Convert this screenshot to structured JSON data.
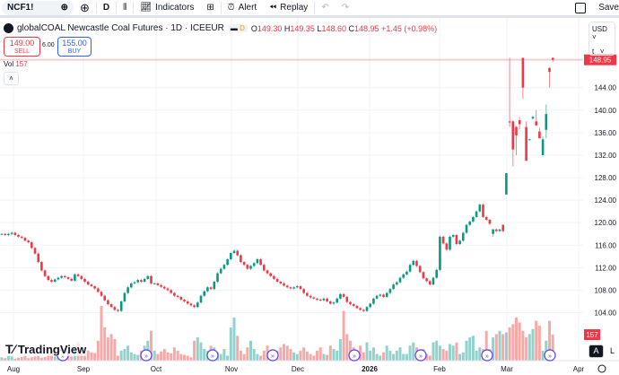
{
  "toolbar": {
    "symbol": "NCF1!",
    "interval": "D",
    "indicators": "Indicators",
    "alert": "Alert",
    "replay": "Replay",
    "save": "Save"
  },
  "legend": {
    "title": "globalCOAL Newcastle Coal Futures · 1D · ICEEUR",
    "flag": "D",
    "o_label": "O",
    "o": "149.30",
    "h_label": "H",
    "h": "149.35",
    "l_label": "L",
    "l": "148.60",
    "c_label": "C",
    "c": "148.95",
    "change": "+1.45 (+0.98%)"
  },
  "trade": {
    "sell_price": "149.00",
    "sell_label": "SELL",
    "spread": "6.00",
    "buy_price": "155.00",
    "buy_label": "BUY"
  },
  "volume": {
    "label": "Vol",
    "value": "157"
  },
  "currency": {
    "value": "USD",
    "unit": "t"
  },
  "scale_buttons": {
    "auto": "A",
    "log": "L"
  },
  "brand": "TradingView",
  "colors": {
    "up": "#089981",
    "down": "#f23645",
    "up_vol": "#92d2cc",
    "down_vol": "#f7a9a7",
    "events": "#5b3cf5"
  },
  "chart_data": {
    "type": "candlestick",
    "ylim": [
      100,
      150
    ],
    "y_ticks": [
      "104.00",
      "108.00",
      "112.00",
      "116.00",
      "120.00",
      "124.00",
      "128.00",
      "132.00",
      "136.00",
      "140.00",
      "144.00"
    ],
    "last_price": "148.95",
    "last_volume": "157",
    "x_ticks": [
      "Aug",
      "Sep",
      "Oct",
      "Nov",
      "Dec",
      "2026",
      "Feb",
      "Mar",
      "Apr"
    ],
    "closes": [
      118,
      117.8,
      118,
      118.2,
      117.8,
      117.5,
      117.3,
      116.8,
      116.5,
      115.5,
      114.5,
      113,
      111.5,
      110.5,
      109.8,
      109.5,
      109.9,
      110.2,
      110.5,
      110.3,
      110,
      109.7,
      110.8,
      110.5,
      110,
      109.5,
      109,
      108.7,
      108.3,
      107.7,
      107,
      106.2,
      105.5,
      105,
      104.5,
      104.3,
      106,
      107.5,
      108.5,
      109.2,
      109.4,
      109.8,
      109.5,
      110,
      110.5,
      109.2,
      109.2,
      108.9,
      108.6,
      108.3,
      108,
      107.5,
      107,
      106.8,
      106.3,
      106,
      105.6,
      105.3,
      105,
      105.8,
      107,
      107.8,
      108.5,
      108.2,
      109.5,
      111,
      111.8,
      112.5,
      113.5,
      114.6,
      115,
      114.2,
      113,
      112.5,
      111.8,
      112.3,
      112.8,
      113.5,
      112.5,
      111.5,
      111,
      110.5,
      110,
      109.5,
      109.2,
      108.8,
      108.5,
      108.3,
      108.5,
      108.7,
      108.2,
      107.5,
      107,
      106.7,
      106.5,
      106.3,
      106.2,
      106.5,
      106,
      105.6,
      105.8,
      106.5,
      107.3,
      106.8,
      105.9,
      105.5,
      105.2,
      104.8,
      104.5,
      104.3,
      105,
      105.6,
      106.5,
      107,
      107.2,
      106.8,
      107.5,
      108.2,
      109,
      109.4,
      110.2,
      110.8,
      111.3,
      112.5,
      113.2,
      112.3,
      111.2,
      110.1,
      109.6,
      109,
      110.2,
      111.6,
      117.5,
      116.3,
      115.2,
      117.5,
      117.8,
      116.2,
      116.8,
      118.2,
      119.6,
      120.2,
      121,
      122,
      123.2,
      121,
      120.5,
      119.8
    ],
    "special_bars": [
      [
        118,
        118.9,
        117.5,
        118.8
      ],
      [
        118.8,
        119,
        118.3,
        118.5
      ],
      [
        118.5,
        118.9,
        118.4,
        118.8
      ],
      [
        119.6,
        119.7,
        118.3,
        118.5
      ],
      [
        125,
        128.8,
        125,
        128.8
      ],
      [
        138,
        149.3,
        137,
        137.8
      ],
      [
        138,
        138.2,
        130,
        133
      ],
      [
        137,
        137.2,
        132,
        135.5
      ],
      [
        138.2,
        138.8,
        136.6,
        137.5
      ],
      [
        149.3,
        149.3,
        142,
        144
      ],
      [
        137,
        138,
        131,
        131
      ],
      [
        134.8,
        134.9,
        134.7,
        134.8
      ],
      [
        138.5,
        139,
        138.4,
        138.8
      ],
      [
        138,
        140,
        137.2,
        137.3
      ],
      [
        136.2,
        136.8,
        135,
        135
      ],
      [
        132,
        135.3,
        132,
        134.8
      ],
      [
        136.5,
        141,
        135,
        139.3
      ],
      [
        147.5,
        147.6,
        144,
        146.8
      ],
      [
        149.3,
        149.35,
        148.6,
        148.95
      ]
    ],
    "volumes": [
      20,
      15,
      30,
      25,
      12,
      18,
      22,
      40,
      15,
      20,
      25,
      30,
      18,
      22,
      80,
      60,
      25,
      35,
      20,
      30,
      50,
      25,
      90,
      110,
      75,
      40,
      60,
      50,
      45,
      120,
      330,
      200,
      140,
      160,
      130,
      30,
      60,
      70,
      90,
      50,
      40,
      35,
      60,
      90,
      120,
      180,
      60,
      40,
      55,
      70,
      50,
      45,
      80,
      60,
      40,
      35,
      30,
      20,
      120,
      140,
      110,
      70,
      60,
      90,
      80,
      50,
      40,
      70,
      30,
      200,
      260,
      150,
      60,
      40,
      80,
      120,
      70,
      40,
      30,
      60,
      90,
      50,
      40,
      60,
      80,
      100,
      90,
      70,
      50,
      40,
      60,
      80,
      55,
      40,
      30,
      60,
      80,
      40,
      35,
      90,
      70,
      60,
      130,
      300,
      160,
      120,
      80,
      60,
      90,
      50,
      110,
      60,
      80,
      40,
      30,
      50,
      90,
      60,
      40,
      60,
      80,
      40,
      40,
      90,
      110,
      80,
      60,
      70,
      40,
      30,
      110,
      120,
      90,
      70,
      60,
      100,
      90,
      110,
      40,
      50,
      120,
      140,
      150,
      60,
      80,
      70,
      180,
      70,
      140,
      160,
      180,
      160,
      170,
      200,
      220,
      260,
      230,
      180,
      140,
      160,
      190,
      240,
      210,
      60,
      120,
      240,
      157
    ]
  }
}
